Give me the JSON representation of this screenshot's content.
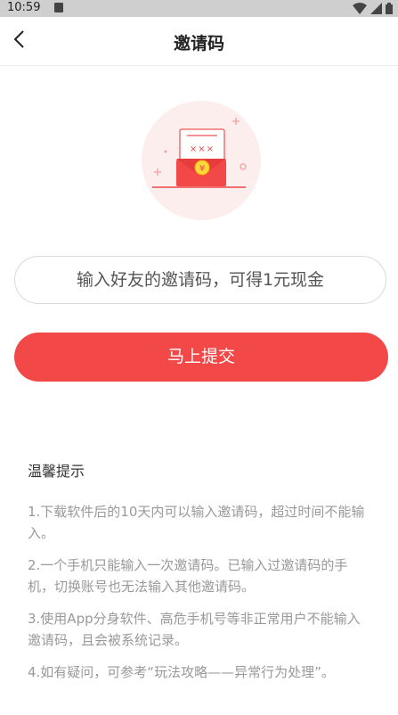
{
  "status_bar": {
    "time": "10:59"
  },
  "header": {
    "title": "邀请码"
  },
  "hero": {
    "mark": "×××",
    "coin": "¥"
  },
  "input": {
    "placeholder": "输入好友的邀请码，可得1元现金"
  },
  "submit": {
    "label": "马上提交"
  },
  "tips": {
    "title": "温馨提示",
    "items": [
      "1.下载软件后的10天内可以输入邀请码，超过时间不能输入。",
      "2.一个手机只能输入一次邀请码。已输入过邀请码的手机，切换账号也无法输入其他邀请码。",
      "3.使用App分身软件、高危手机号等非正常用户不能输入邀请码，且会被系统记录。",
      "4.如有疑问，可参考“玩法攻略——异常行为处理”。"
    ]
  },
  "colors": {
    "accent": "#f24848",
    "hero_bg": "#fdeeee"
  }
}
